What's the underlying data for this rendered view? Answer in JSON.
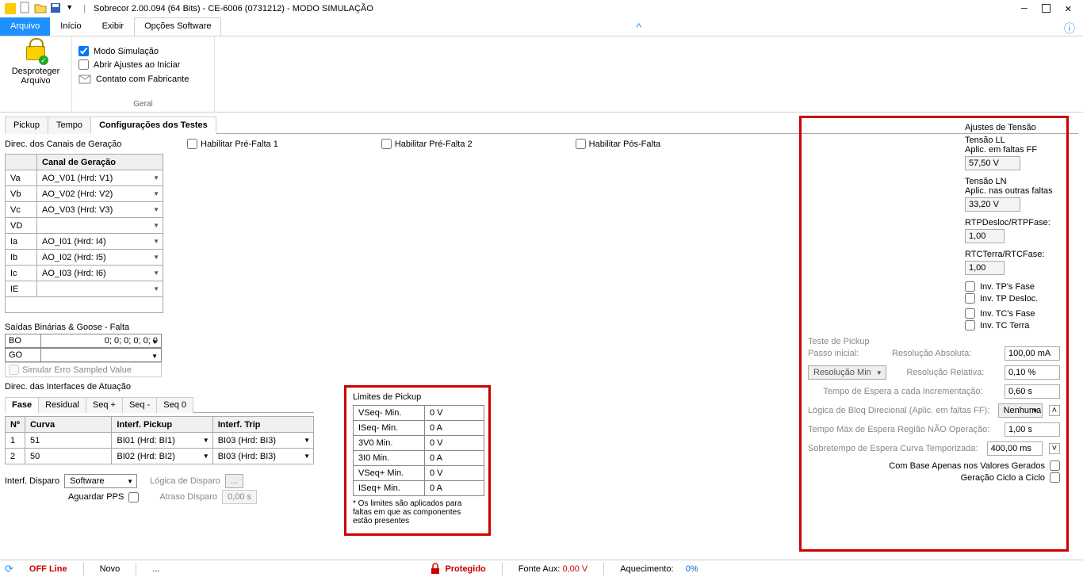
{
  "title": "Sobrecor 2.00.094 (64 Bits) - CE-6006 (0731212) - MODO SIMULAÇÃO",
  "ribbon": {
    "file": "Arquivo",
    "inicio": "Início",
    "exibir": "Exibir",
    "opcoes": "Opções Software",
    "desproteger1": "Desproteger",
    "desproteger2": "Arquivo",
    "modo_sim": "Modo Simulação",
    "abrir_iniciar": "Abrir Ajustes ao Iniciar",
    "contato_fab": "Contato com Fabricante",
    "geral": "Geral"
  },
  "subtabs": {
    "pickup": "Pickup",
    "tempo": "Tempo",
    "config": "Configurações dos Testes"
  },
  "row1": {
    "direc": "Direc. dos Canais de Geração",
    "hab_pre1": "Habilitar Pré-Falta 1",
    "hab_pre2": "Habilitar Pré-Falta 2",
    "hab_pos": "Habilitar Pós-Falta"
  },
  "gentable": {
    "header": "Canal de Geração",
    "rows": [
      {
        "k": "Va",
        "v": "AO_V01 (Hrd: V1)"
      },
      {
        "k": "Vb",
        "v": "AO_V02 (Hrd: V2)"
      },
      {
        "k": "Vc",
        "v": "AO_V03 (Hrd: V3)"
      },
      {
        "k": "VD",
        "v": ""
      },
      {
        "k": "Ia",
        "v": "AO_I01 (Hrd: I4)"
      },
      {
        "k": "Ib",
        "v": "AO_I02 (Hrd: I5)"
      },
      {
        "k": "Ic",
        "v": "AO_I03 (Hrd: I6)"
      },
      {
        "k": "IE",
        "v": ""
      }
    ]
  },
  "saidas": {
    "label": "Saídas Binárias & Goose - Falta",
    "bo": "BO",
    "bo_v": "0; 0; 0; 0; 0; 0",
    "go": "GO",
    "go_v": "",
    "simul_err": "Simular Erro Sampled Value"
  },
  "interfaces": {
    "label": "Direc. das Interfaces de Atuação",
    "tabs": [
      "Fase",
      "Residual",
      "Seq +",
      "Seq -",
      "Seq 0"
    ],
    "hdr": {
      "n": "Nº",
      "curva": "Curva",
      "ipick": "Interf. Pickup",
      "itrip": "Interf. Trip"
    },
    "rows": [
      {
        "n": "1",
        "curva": "51",
        "ipick": "BI01 (Hrd: BI1)",
        "itrip": "BI03 (Hrd: BI3)"
      },
      {
        "n": "2",
        "curva": "50",
        "ipick": "BI02 (Hrd: BI2)",
        "itrip": "BI03 (Hrd: BI3)"
      }
    ],
    "disp_lbl": "Interf. Disparo",
    "disp_val": "Software",
    "log_disp": "Lógica de Disparo",
    "dots": "...",
    "aguardar": "Aguardar PPS",
    "atraso": "Atraso Disparo",
    "atraso_v": "0,00 s"
  },
  "limites": {
    "hdr": "Limites de Pickup",
    "rows": [
      {
        "k": "VSeq- Min.",
        "v": "0 V"
      },
      {
        "k": "ISeq- Min.",
        "v": "0 A"
      },
      {
        "k": "3V0 Min.",
        "v": "0 V"
      },
      {
        "k": "3I0 Min.",
        "v": "0 A"
      },
      {
        "k": "VSeq+ Min.",
        "v": "0 V"
      },
      {
        "k": "ISeq+ Min.",
        "v": "0 A"
      }
    ],
    "note": "* Os limites são aplicados para faltas em que as componentes estão presentes"
  },
  "right": {
    "ajustes": "Ajustes de Tensão",
    "ll_lbl": "Tensão LL",
    "ll_sub": "Aplic. em faltas FF",
    "ll_v": "57,50 V",
    "ln_lbl": "Tensão LN",
    "ln_sub": "Aplic. nas outras faltas",
    "ln_v": "33,20 V",
    "rtpd": "RTPDesloc/RTPFase:",
    "rtpd_v": "1,00",
    "rtc": "RTCTerra/RTCFase:",
    "rtc_v": "1,00",
    "chk1": "Inv. TP's Fase",
    "chk2": "Inv. TP Desloc.",
    "chk3": "Inv. TC's Fase",
    "chk4": "Inv. TC Terra",
    "teste": "Teste de Pickup",
    "passo": "Passo inicial:",
    "resabs": "Resolução Absoluta:",
    "resabs_v": "100,00 mA",
    "resmin": "Resolução Min",
    "resrel": "Resolução Relativa:",
    "resrel_v": "0,10 %",
    "tempoesp": "Tempo de Espera a cada Incrementação:",
    "tempoesp_v": "0,60 s",
    "logbloq": "Lógica de Bloq Direcional (Aplic. em faltas FF):",
    "logbloq_v": "Nenhuma",
    "tempomax": "Tempo Máx de Espera Região NÃO Operação:",
    "tempomax_v": "1,00 s",
    "sobretempo": "Sobretempo de Espera Curva Temporizada:",
    "sobretempo_v": "400,00 ms",
    "combase": "Com Base Apenas nos Valores Gerados",
    "geracao": "Geração Ciclo a Ciclo"
  },
  "status": {
    "off": "OFF Line",
    "novo": "Novo",
    "dots": "...",
    "prot": "Protegido",
    "fonte": "Fonte Aux:",
    "fonte_v": "0,00 V",
    "aquec": "Aquecimento:",
    "aquec_v": "0%"
  }
}
